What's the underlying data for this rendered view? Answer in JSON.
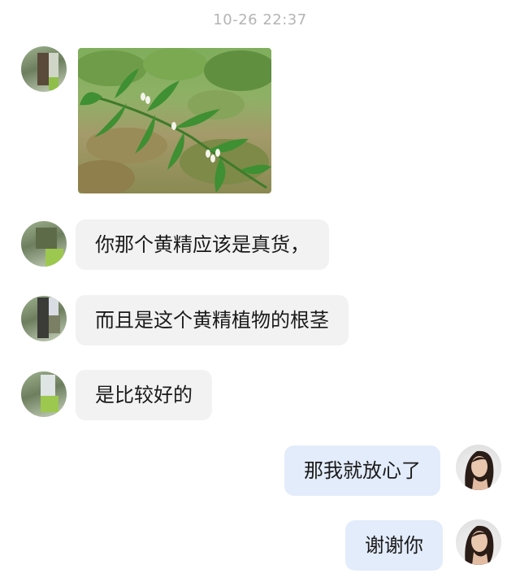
{
  "chat": {
    "timestamp": "10-26 22:37",
    "messages": [
      {
        "type": "image",
        "from": "other"
      },
      {
        "type": "text",
        "from": "other",
        "text": "你那个黄精应该是真货，"
      },
      {
        "type": "text",
        "from": "other",
        "text": "而且是这个黄精植物的根茎"
      },
      {
        "type": "text",
        "from": "other",
        "text": "是比较好的"
      },
      {
        "type": "text",
        "from": "me",
        "text": "那我就放心了"
      },
      {
        "type": "text",
        "from": "me",
        "text": "谢谢你"
      }
    ]
  },
  "colors": {
    "incoming_bubble": "#f2f2f2",
    "outgoing_bubble": "#e3ecfb",
    "timestamp_text": "#b4b4b4"
  },
  "icons": {
    "contact_avatar": "contact-avatar-icon",
    "user_avatar": "user-avatar-icon"
  }
}
